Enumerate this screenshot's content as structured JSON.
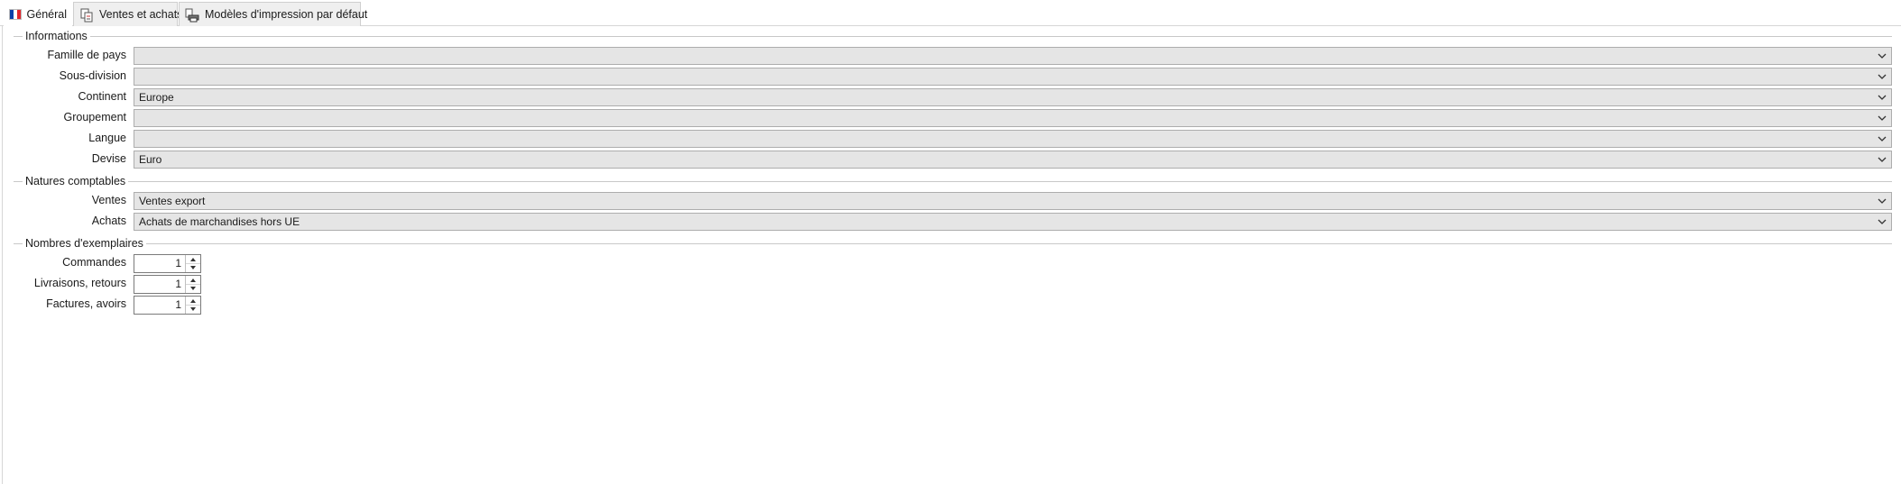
{
  "tabs": [
    {
      "label": "Général",
      "icon": "flag-france-icon",
      "active": true
    },
    {
      "label": "Ventes et achats",
      "icon": "documents-icon",
      "active": false
    },
    {
      "label": "Modèles d'impression par défaut",
      "icon": "printer-icon",
      "active": false
    }
  ],
  "sections": {
    "informations": "Informations",
    "natures": "Natures comptables",
    "exemplaires": "Nombres d'exemplaires"
  },
  "fields": {
    "famille_de_pays": {
      "label": "Famille de pays",
      "value": ""
    },
    "sous_division": {
      "label": "Sous-division",
      "value": ""
    },
    "continent": {
      "label": "Continent",
      "value": "Europe"
    },
    "groupement": {
      "label": "Groupement",
      "value": ""
    },
    "langue": {
      "label": "Langue",
      "value": ""
    },
    "devise": {
      "label": "Devise",
      "value": "Euro"
    },
    "ventes": {
      "label": "Ventes",
      "value": "Ventes export"
    },
    "achats": {
      "label": "Achats",
      "value": "Achats de marchandises hors UE"
    }
  },
  "copies": {
    "commandes": {
      "label": "Commandes",
      "value": "1"
    },
    "livraisons": {
      "label": "Livraisons, retours",
      "value": "1"
    },
    "factures": {
      "label": "Factures, avoirs",
      "value": "1"
    }
  },
  "colors": {
    "flag_blue": "#0b3fa8",
    "flag_white": "#ffffff",
    "flag_red": "#e1262d"
  }
}
